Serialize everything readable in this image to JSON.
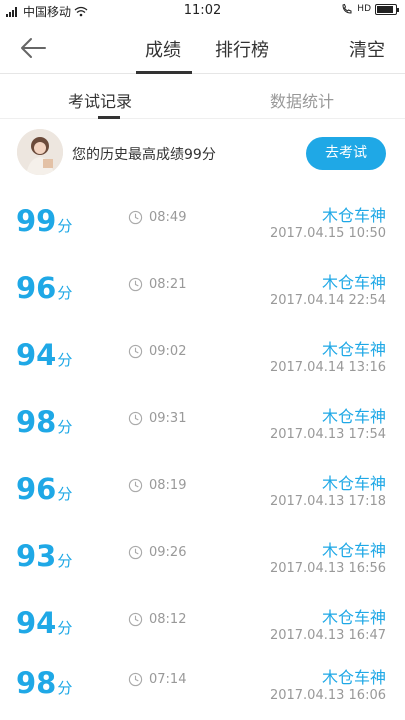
{
  "status_bar": {
    "carrier": "中国移动",
    "time": "11:02",
    "network": "HD",
    "battery_level": 0.85
  },
  "header": {
    "tabs": [
      {
        "label": "成绩",
        "active": true
      },
      {
        "label": "排行榜",
        "active": false
      }
    ],
    "clear_label": "清空"
  },
  "subtabs": [
    {
      "label": "考试记录",
      "active": true
    },
    {
      "label": "数据统计",
      "active": false
    }
  ],
  "summary": {
    "text": "您的历史最高成绩99分",
    "button_label": "去考试"
  },
  "records": [
    {
      "score": "99",
      "unit": "分",
      "duration": "08:49",
      "name": "木仓车神",
      "date": "2017.04.15  10:50"
    },
    {
      "score": "96",
      "unit": "分",
      "duration": "08:21",
      "name": "木仓车神",
      "date": "2017.04.14  22:54"
    },
    {
      "score": "94",
      "unit": "分",
      "duration": "09:02",
      "name": "木仓车神",
      "date": "2017.04.14  13:16"
    },
    {
      "score": "98",
      "unit": "分",
      "duration": "09:31",
      "name": "木仓车神",
      "date": "2017.04.13  17:54"
    },
    {
      "score": "96",
      "unit": "分",
      "duration": "08:19",
      "name": "木仓车神",
      "date": "2017.04.13  17:18"
    },
    {
      "score": "93",
      "unit": "分",
      "duration": "09:26",
      "name": "木仓车神",
      "date": "2017.04.13  16:56"
    },
    {
      "score": "94",
      "unit": "分",
      "duration": "08:12",
      "name": "木仓车神",
      "date": "2017.04.13  16:47"
    },
    {
      "score": "98",
      "unit": "分",
      "duration": "07:14",
      "name": "木仓车神",
      "date": "2017.04.13  16:06"
    }
  ],
  "colors": {
    "accent": "#1fa8e6",
    "text": "#333333",
    "muted": "#999999"
  }
}
